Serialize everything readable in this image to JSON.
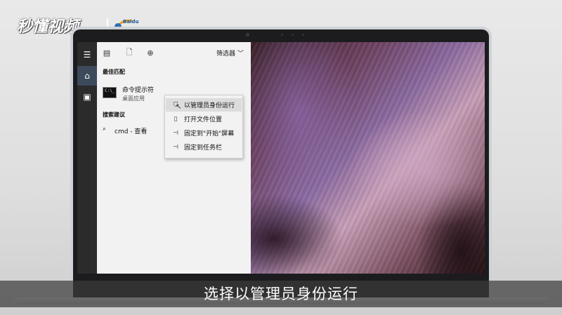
{
  "watermark": {
    "brand": "秒懂视频",
    "partner": "Baidu"
  },
  "start_panel": {
    "filter_label": "筛选器",
    "best_match_title": "最佳匹配",
    "app_name": "命令提示符",
    "app_type": "桌面应用",
    "search_suggest_title": "搜索建议",
    "suggest_query": "cmd - 查看"
  },
  "context_menu": {
    "items": [
      {
        "label": "以管理员身份运行",
        "icon": "shield-icon"
      },
      {
        "label": "打开文件位置",
        "icon": "file-icon"
      },
      {
        "label": "固定到\"开始\"屏幕",
        "icon": "pin-icon"
      },
      {
        "label": "固定到任务栏",
        "icon": "pin-icon"
      }
    ]
  },
  "subtitle": "选择以管理员身份运行",
  "colors": {
    "accent": "#3d4a5c",
    "taskbar": "#2b2b2b",
    "panel": "#f2f2f2"
  }
}
